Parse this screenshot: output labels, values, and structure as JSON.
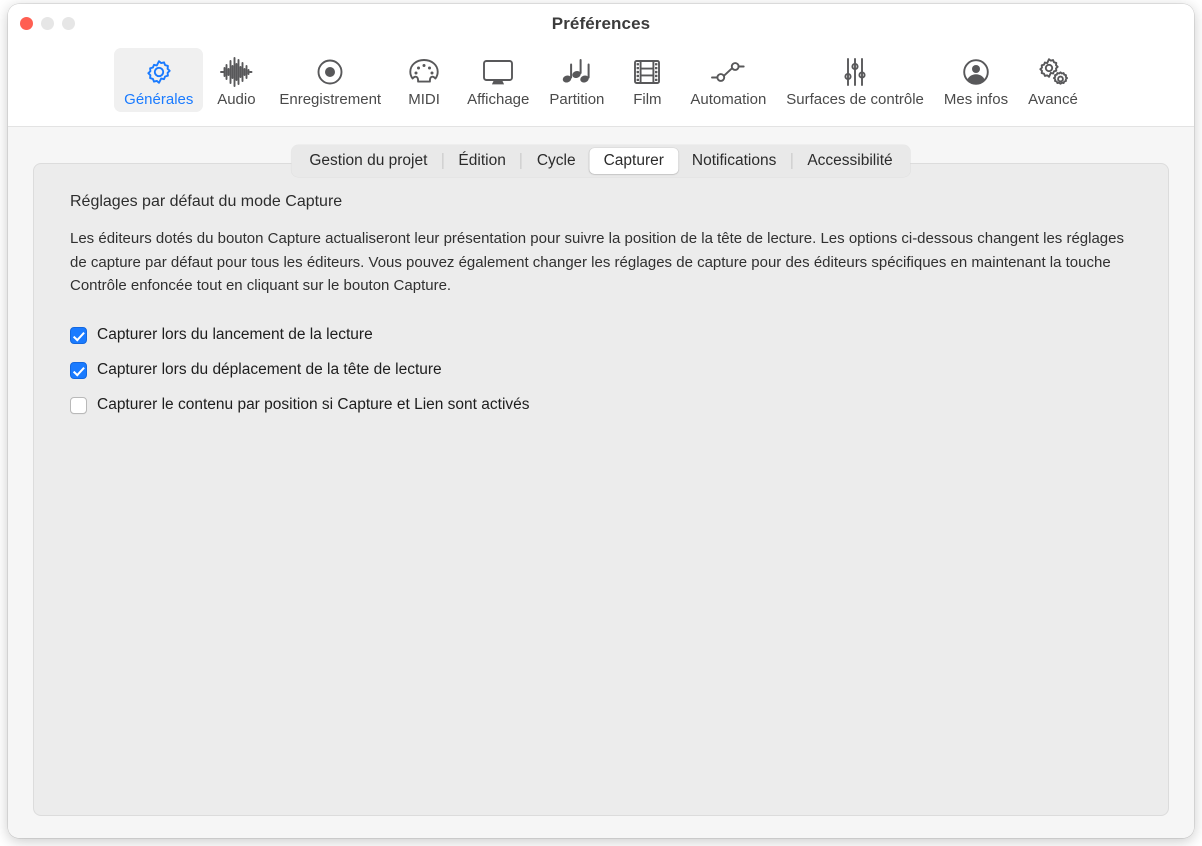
{
  "window": {
    "title": "Préférences",
    "traffic_lights": [
      {
        "name": "close",
        "color": "#ff5f52"
      },
      {
        "name": "minimize",
        "color": "#e6e6e6"
      },
      {
        "name": "maximize",
        "color": "#e6e6e6"
      }
    ]
  },
  "toolbar": {
    "items": [
      {
        "label": "Générales",
        "icon": "gear-icon",
        "selected": true
      },
      {
        "label": "Audio",
        "icon": "waveform-icon",
        "selected": false
      },
      {
        "label": "Enregistrement",
        "icon": "record-circle-icon",
        "selected": false
      },
      {
        "label": "MIDI",
        "icon": "midi-port-icon",
        "selected": false
      },
      {
        "label": "Affichage",
        "icon": "display-icon",
        "selected": false
      },
      {
        "label": "Partition",
        "icon": "music-notes-icon",
        "selected": false
      },
      {
        "label": "Film",
        "icon": "film-strip-icon",
        "selected": false
      },
      {
        "label": "Automation",
        "icon": "automation-node-icon",
        "selected": false
      },
      {
        "label": "Surfaces de contrôle",
        "icon": "sliders-icon",
        "selected": false
      },
      {
        "label": "Mes infos",
        "icon": "user-circle-icon",
        "selected": false
      },
      {
        "label": "Avancé",
        "icon": "double-gear-icon",
        "selected": false
      }
    ],
    "selected_accent_color": "#1a7bff"
  },
  "tabs": [
    {
      "label": "Gestion du projet",
      "active": false
    },
    {
      "label": "Édition",
      "active": false
    },
    {
      "label": "Cycle",
      "active": false
    },
    {
      "label": "Capturer",
      "active": true
    },
    {
      "label": "Notifications",
      "active": false
    },
    {
      "label": "Accessibilité",
      "active": false
    }
  ],
  "content": {
    "section_title": "Réglages par défaut du mode Capture",
    "description": "Les éditeurs dotés du bouton Capture actualiseront leur présentation pour suivre la position de la tête de lecture. Les options ci-dessous changent les réglages de capture par défaut pour tous les éditeurs. Vous pouvez également changer les réglages de capture pour des éditeurs spécifiques en maintenant la touche Contrôle enfoncée tout en cliquant sur le bouton Capture.",
    "checkboxes": [
      {
        "label": "Capturer lors du lancement de la lecture",
        "checked": true
      },
      {
        "label": "Capturer lors du déplacement de la tête de lecture",
        "checked": true
      },
      {
        "label": "Capturer le contenu par position si Capture et Lien sont activés",
        "checked": false
      }
    ],
    "checkbox_checked_color": "#1a7bff"
  }
}
